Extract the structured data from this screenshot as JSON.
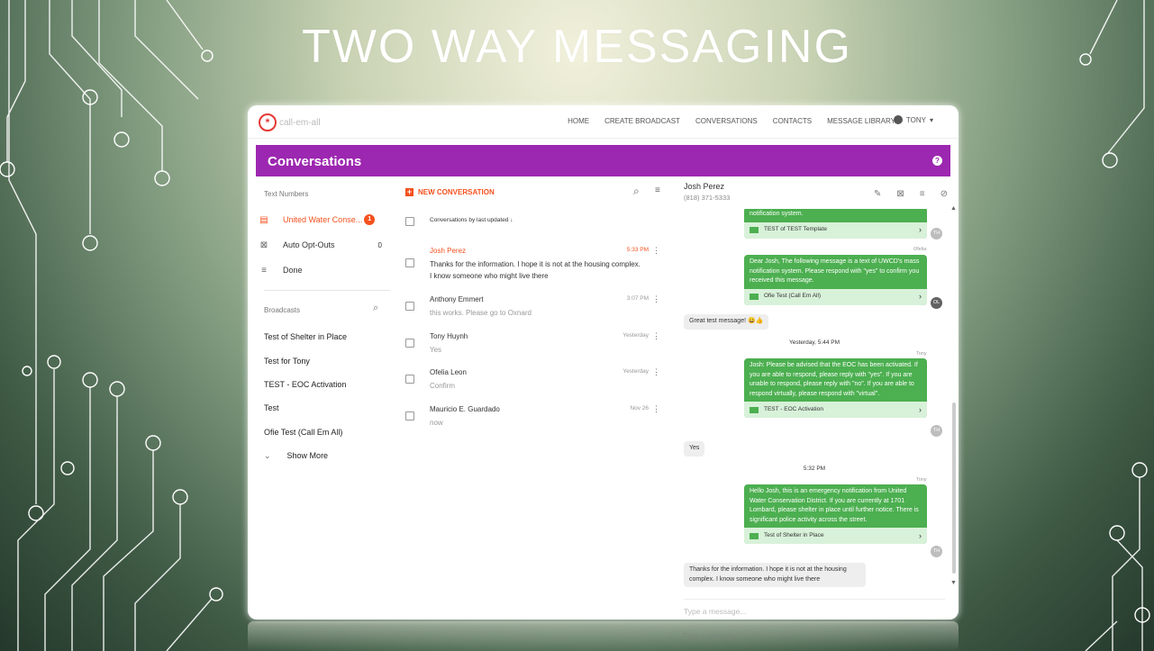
{
  "slide": {
    "title": "TWO WAY MESSAGING"
  },
  "app": {
    "logo_text": "call-em-all",
    "nav": [
      "HOME",
      "CREATE BROADCAST",
      "CONVERSATIONS",
      "CONTACTS",
      "MESSAGE LIBRARY"
    ],
    "user": "TONY"
  },
  "header": {
    "title": "Conversations"
  },
  "left_panel": {
    "text_numbers_label": "Text Numbers",
    "items": [
      {
        "label": "United Water Conse...",
        "count": "1",
        "icon": "inbox-icon"
      },
      {
        "label": "Auto Opt-Outs",
        "count": "0",
        "icon": "opt-out-icon"
      },
      {
        "label": "Done",
        "count": "",
        "icon": "done-list-icon"
      }
    ],
    "broadcasts_label": "Broadcasts",
    "broadcasts": [
      "Test of Shelter in Place",
      "Test for Tony",
      "TEST - EOC Activation",
      "Test",
      "Ofie Test (Call Em All)"
    ],
    "show_more": "Show More"
  },
  "middle_panel": {
    "new_conversation": "NEW CONVERSATION",
    "sort_label": "Conversations by last updated ↓",
    "conversations": [
      {
        "name": "Josh Perez",
        "preview": "Thanks for the information. I hope it is not at the housing complex. I know someone who might live there",
        "time": "5:33 PM"
      },
      {
        "name": "Anthony Emmert",
        "preview": "this works. Please go to Oxnard",
        "time": "3:07 PM"
      },
      {
        "name": "Tony Huynh",
        "preview": "Yes",
        "time": "Yesterday"
      },
      {
        "name": "Ofelia Leon",
        "preview": "Confirm",
        "time": "Yesterday"
      },
      {
        "name": "Mauricio E. Guardado",
        "preview": "now",
        "time": "Nov 26"
      }
    ]
  },
  "thread": {
    "contact_name": "Josh Perez",
    "contact_phone": "(818) 371-5333",
    "messages": [
      {
        "text": "notification system.",
        "template": "TEST of TEST Template",
        "avatar": "TH"
      },
      {
        "sender": "Ofelia",
        "text": "Dear Josh, The following message is a text of UWCD's mass notification system. Please respond with \"yes\" to confirm you received this message.",
        "template": "Ofie Test (Call Em All)",
        "avatar": "OL"
      },
      {
        "incoming": "Great test message! 😀👍"
      },
      {
        "divider": "Yesterday, 5:44 PM"
      },
      {
        "sender": "Tony",
        "text": "Josh: Please be advised that the EOC has been activated. If you are able to respond, please reply with \"yes\". If you are unable to respond, please reply with \"no\". If you are able to respond virtually, please respond with \"virtual\".",
        "template": "TEST - EOC Activation",
        "avatar": "TH"
      },
      {
        "incoming": "Yes"
      },
      {
        "divider": "5:32 PM"
      },
      {
        "sender": "Tony",
        "text": "Hello Josh, this is an emergency notification from United Water Conservation District. If you are currently at 1701 Lombard, please shelter in place until further notice. There is significant police activity across the street.",
        "template": "Test of Shelter in Place",
        "avatar": "TH"
      },
      {
        "incoming": "Thanks for the information. I hope it is not at the housing complex. I know someone who might live there"
      }
    ],
    "compose_placeholder": "Type a message..."
  },
  "colors": {
    "purple": "#9c27b0",
    "orange": "#f4511e",
    "green": "#4caf50"
  }
}
